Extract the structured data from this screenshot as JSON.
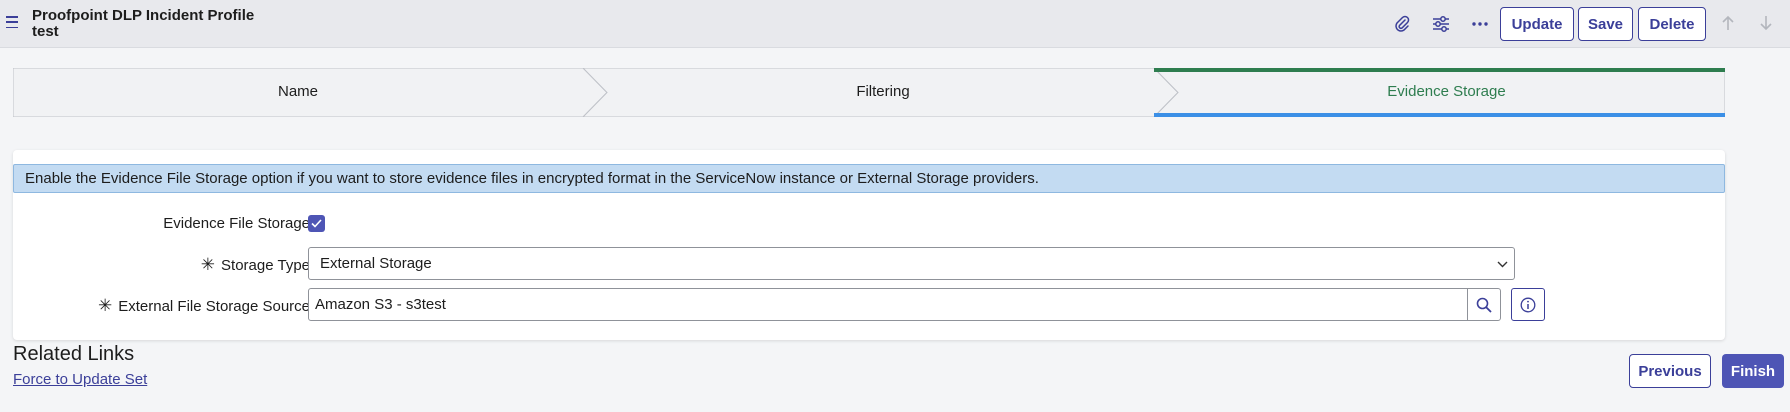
{
  "header": {
    "title_line1": "Proofpoint DLP Incident Profile",
    "title_line2": "test",
    "buttons": {
      "update": "Update",
      "save": "Save",
      "delete": "Delete"
    },
    "icons": [
      "menu-icon",
      "paperclip-icon",
      "sliders-icon",
      "more-icon",
      "arrow-up-icon",
      "arrow-down-icon"
    ]
  },
  "wizard": {
    "steps": [
      {
        "label": "Name",
        "state": "completed"
      },
      {
        "label": "Filtering",
        "state": "completed"
      },
      {
        "label": "Evidence Storage",
        "state": "active"
      }
    ],
    "active_color": "#2e7d4f",
    "active_underline": "#3b8fe6"
  },
  "form": {
    "info_message": "Enable the Evidence File Storage option if you want to store evidence files in encrypted format in the ServiceNow instance or External Storage providers.",
    "evidence_file_storage": {
      "label": "Evidence File Storage",
      "checked": true
    },
    "storage_type": {
      "label": "Storage Type",
      "required_mark": "✳",
      "value": "External Storage"
    },
    "external_source": {
      "label": "External File Storage Source",
      "required_mark": "✳",
      "value": "Amazon S3 - s3test"
    }
  },
  "related": {
    "title": "Related Links",
    "link": "Force to Update Set"
  },
  "footer": {
    "previous": "Previous",
    "finish": "Finish"
  },
  "colors": {
    "accent": "#3b3f99",
    "primary_button": "#4e55b5",
    "info_background": "#c3dbf2"
  }
}
